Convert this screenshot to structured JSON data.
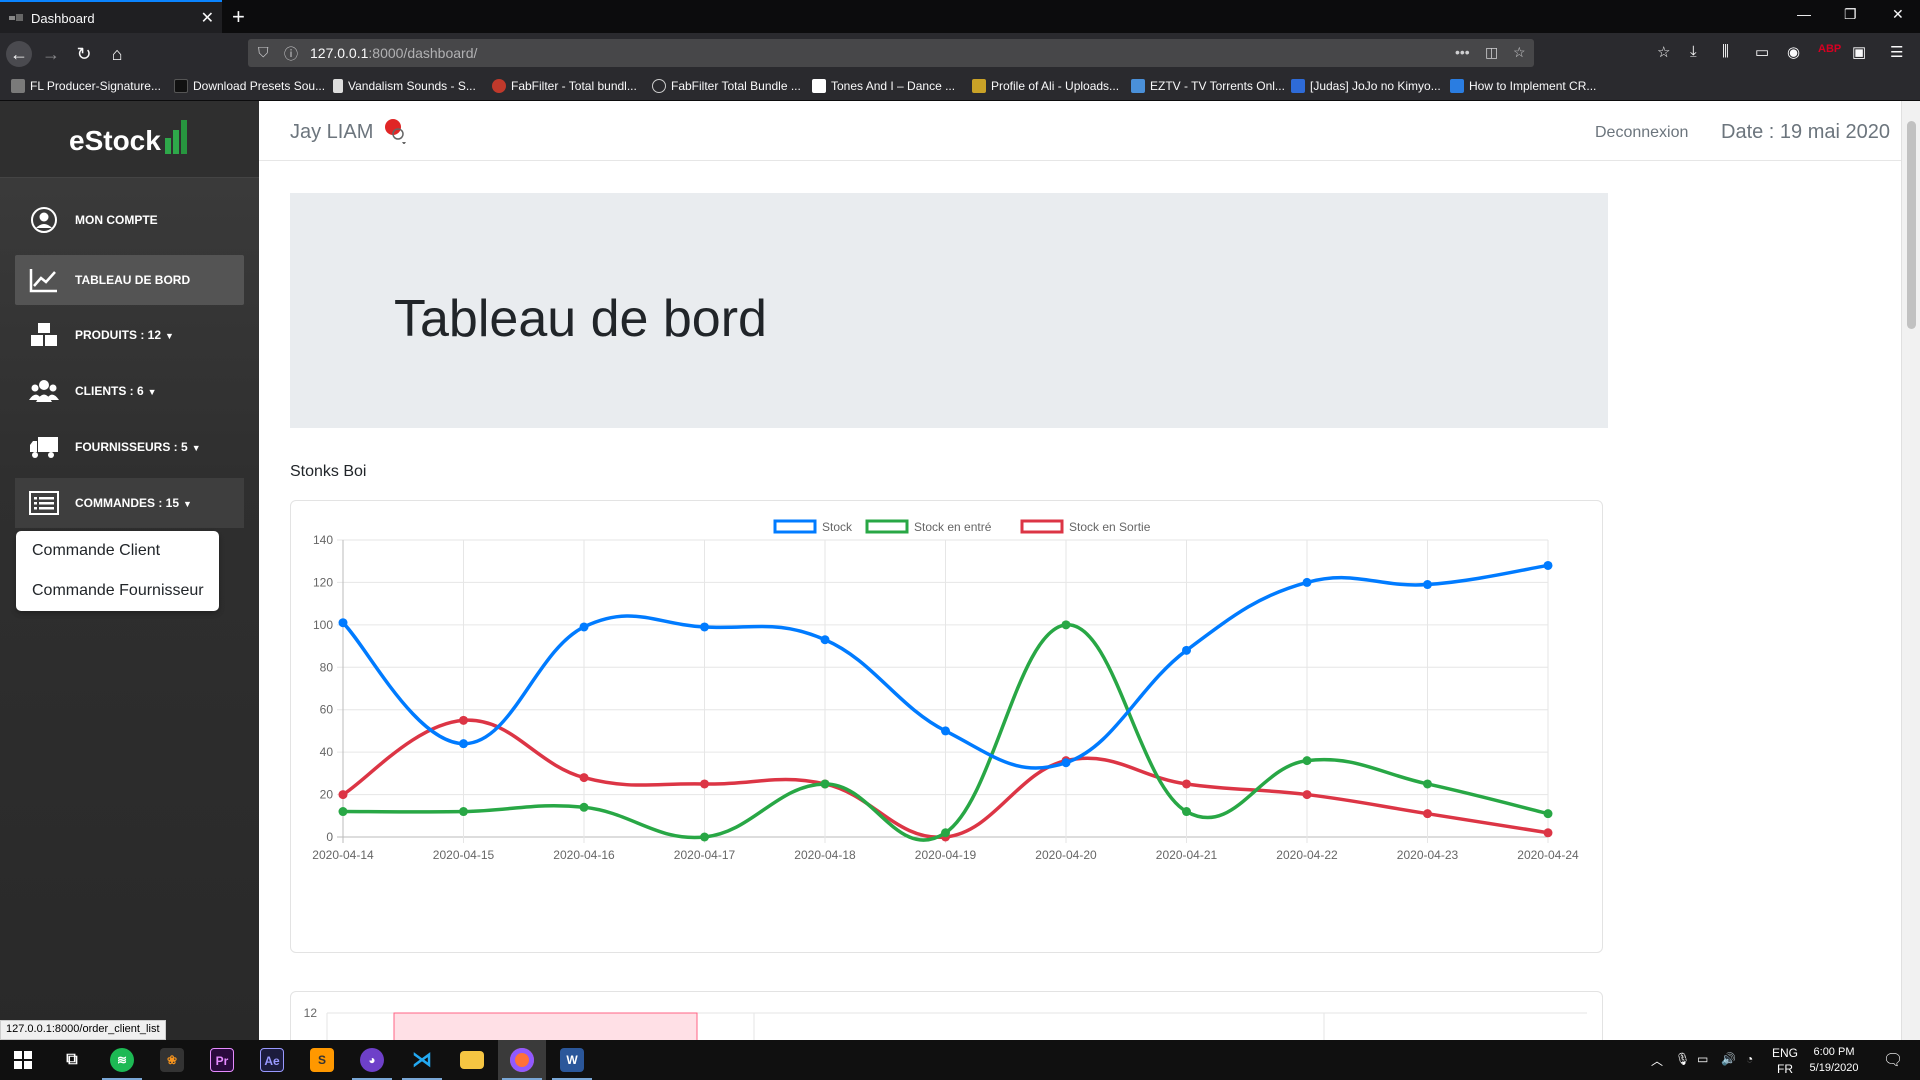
{
  "browser": {
    "tab_title": "Dashboard",
    "url_host": "127.0.0.1",
    "url_rest": ":8000/dashboard/",
    "bookmarks": [
      "FL Producer-Signature...",
      "Download Presets Sou...",
      "Vandalism Sounds - S...",
      "FabFilter - Total bundl...",
      "FabFilter Total Bundle ...",
      "Tones And I – Dance ...",
      "Profile of Ali - Uploads...",
      "EZTV - TV Torrents Onl...",
      "[Judas] JoJo no Kimyo...",
      "How to Implement CR..."
    ],
    "status_url": "127.0.0.1:8000/order_client_list"
  },
  "sidebar": {
    "brand": "eStock",
    "items": [
      {
        "label": "MON COMPTE",
        "icon": "user-circle-icon"
      },
      {
        "label": "TABLEAU DE BORD",
        "icon": "chart-line-icon"
      },
      {
        "label": "PRODUITS : 12",
        "icon": "boxes-icon"
      },
      {
        "label": "CLIENTS : 6",
        "icon": "users-icon"
      },
      {
        "label": "FOURNISSEURS : 5",
        "icon": "truck-icon"
      },
      {
        "label": "COMMANDES : 15",
        "icon": "list-icon"
      }
    ],
    "dropdown": [
      "Commande Client",
      "Commande Fournisseur"
    ]
  },
  "header": {
    "username": "Jay LIAM",
    "logout": "Deconnexion",
    "date": "Date : 19 mai 2020"
  },
  "page": {
    "title": "Tableau de bord",
    "section_title": "Stonks Boi"
  },
  "chart_data": [
    {
      "type": "line",
      "x": [
        "2020-04-14",
        "2020-04-15",
        "2020-04-16",
        "2020-04-17",
        "2020-04-18",
        "2020-04-19",
        "2020-04-20",
        "2020-04-21",
        "2020-04-22",
        "2020-04-23",
        "2020-04-24"
      ],
      "ylim": [
        0,
        140
      ],
      "yticks": [
        0,
        20,
        40,
        60,
        80,
        100,
        120,
        140
      ],
      "grid": true,
      "legend_position": "top-center",
      "series": [
        {
          "name": "Stock",
          "color": "#007bff",
          "values": [
            101,
            44,
            99,
            99,
            93,
            50,
            35,
            88,
            120,
            119,
            128
          ]
        },
        {
          "name": "Stock en entré",
          "color": "#28a745",
          "values": [
            12,
            12,
            14,
            0,
            25,
            2,
            100,
            12,
            36,
            25,
            11
          ]
        },
        {
          "name": "Stock en Sortie",
          "color": "#dc3545",
          "values": [
            20,
            55,
            28,
            25,
            25,
            0,
            36,
            25,
            20,
            11,
            2
          ]
        }
      ]
    },
    {
      "type": "bar",
      "yticks": [
        12
      ]
    }
  ],
  "taskbar": {
    "lang_top": "ENG",
    "lang_bottom": "FR",
    "time": "6:00 PM",
    "date": "5/19/2020"
  }
}
